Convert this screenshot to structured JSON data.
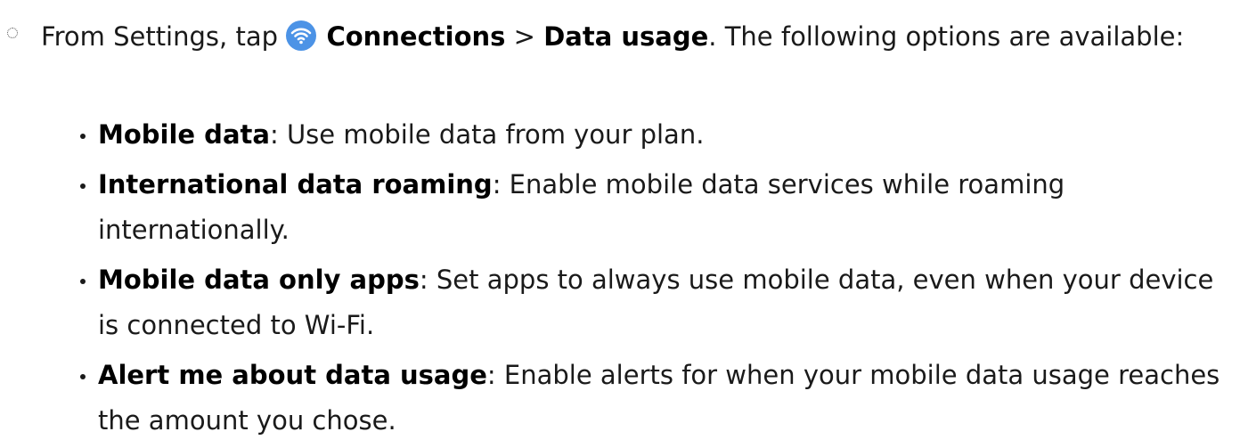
{
  "intro": {
    "prefix": "From Settings, tap ",
    "connections_label": "Connections",
    "separator": " > ",
    "data_usage_label": "Data usage",
    "suffix": ". The following options are available:"
  },
  "icons": {
    "connections": "wifi-icon",
    "accent_color": "#4c93e6"
  },
  "options": [
    {
      "title": "Mobile data",
      "description": ": Use mobile data from your plan."
    },
    {
      "title": "International data roaming",
      "description": ": Enable mobile data services while roaming internationally."
    },
    {
      "title": "Mobile data only apps",
      "description": ": Set apps to always use mobile data, even when your device is connected to Wi-Fi."
    },
    {
      "title": "Alert me about data usage",
      "description": ": Enable alerts for when your mobile data usage reaches the amount you chose."
    }
  ]
}
